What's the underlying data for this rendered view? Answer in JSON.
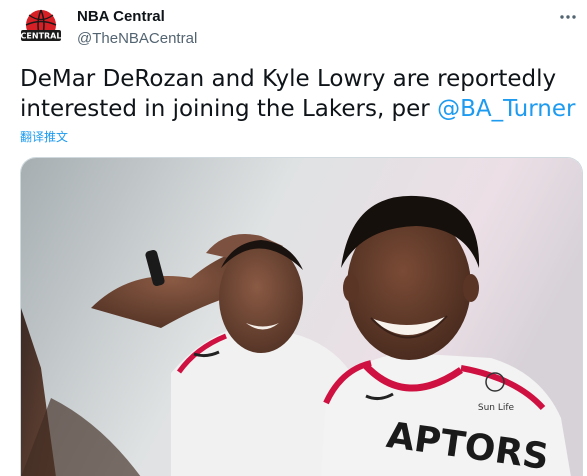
{
  "author": {
    "name": "NBA Central",
    "handle": "@TheNBACentral",
    "avatar_text": "CENTRAL"
  },
  "menu": {
    "icon": "more-horizontal-icon"
  },
  "tweet": {
    "text": "DeMar DeRozan and Kyle Lowry are reportedly interested in joining the Lakers, per ",
    "mention": "@BA_Turner",
    "translate_label": "翻译推文"
  },
  "media": {
    "jersey_text": "APTORS",
    "sponsor_text": "Sun Life"
  },
  "colors": {
    "link": "#1d9bf0",
    "secondary_text": "#536471",
    "primary_text": "#0f1419",
    "raptors_red": "#ce1141"
  }
}
